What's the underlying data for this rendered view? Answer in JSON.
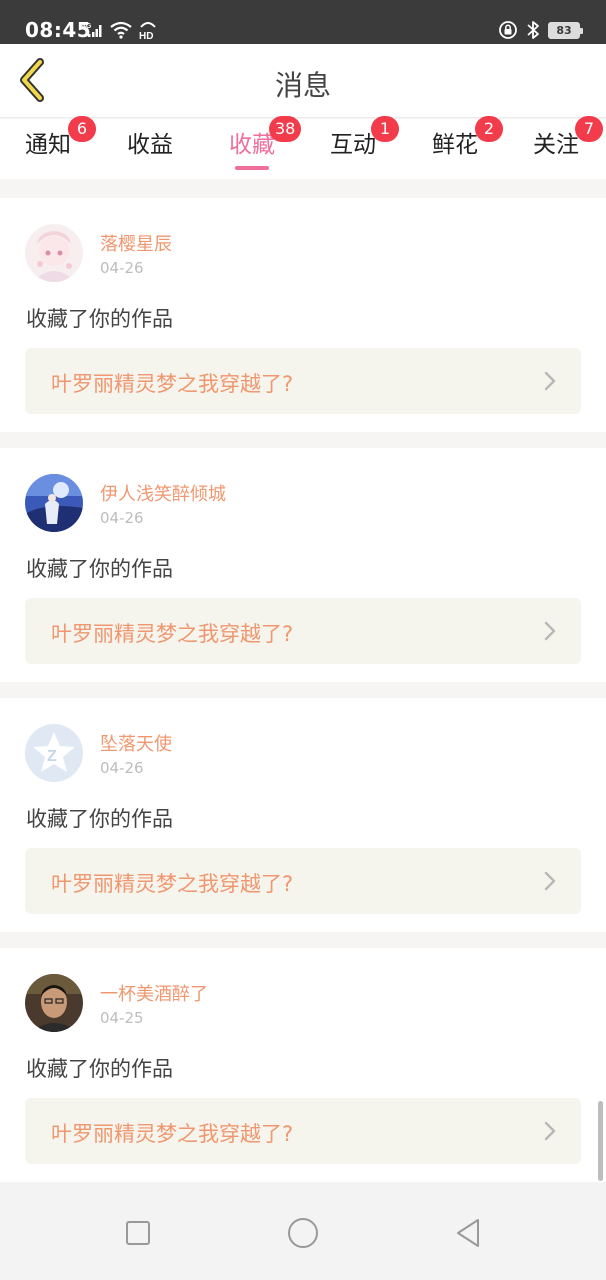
{
  "status_bar": {
    "time": "08:45",
    "battery": "83",
    "icons": [
      "signal-4g-icon",
      "wifi-icon",
      "hd-icon",
      "lock-rotation-icon",
      "bluetooth-icon",
      "battery-icon"
    ]
  },
  "header": {
    "title": "消息",
    "back_icon": "chevron-left-icon"
  },
  "tabs": [
    {
      "label": "通知",
      "badge": "6",
      "active": false
    },
    {
      "label": "收益",
      "badge": "",
      "active": false
    },
    {
      "label": "收藏",
      "badge": "38",
      "active": true
    },
    {
      "label": "互动",
      "badge": "1",
      "active": false
    },
    {
      "label": "鲜花",
      "badge": "2",
      "active": false
    },
    {
      "label": "关注",
      "badge": "7",
      "active": false
    }
  ],
  "colors": {
    "accent": "#ee6f9c",
    "badge": "#f23c4c",
    "name": "#f0976f",
    "card_link_bg": "#f5f5ee"
  },
  "feed": [
    {
      "name": "落樱星辰",
      "date": "04-26",
      "action": "收藏了你的作品",
      "work": "叶罗丽精灵梦之我穿越了?"
    },
    {
      "name": "伊人浅笑醉倾城",
      "date": "04-26",
      "action": "收藏了你的作品",
      "work": "叶罗丽精灵梦之我穿越了?"
    },
    {
      "name": "坠落天使",
      "date": "04-26",
      "action": "收藏了你的作品",
      "work": "叶罗丽精灵梦之我穿越了?"
    },
    {
      "name": "一杯美酒醉了",
      "date": "04-25",
      "action": "收藏了你的作品",
      "work": "叶罗丽精灵梦之我穿越了?"
    }
  ],
  "nav": [
    "recent-apps-icon",
    "home-icon",
    "back-icon"
  ]
}
